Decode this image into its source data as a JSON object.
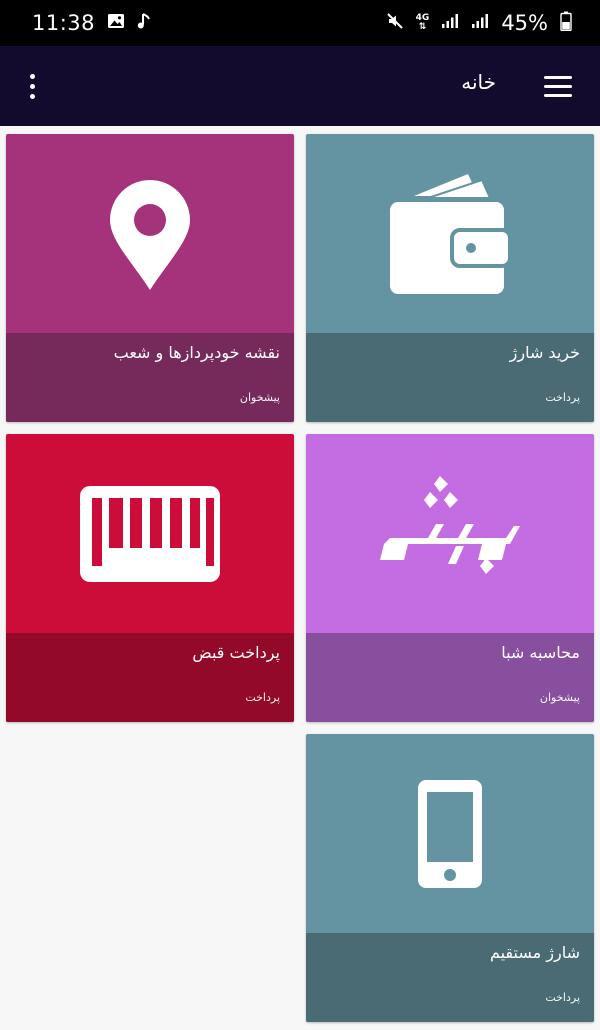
{
  "status_bar": {
    "time": "11:38",
    "network_type": "4G",
    "battery_percent": "45%",
    "left_icons": [
      "image-icon",
      "music-note-icon"
    ],
    "right_icons": [
      "mute-icon",
      "signal-icon",
      "signal-icon",
      "battery-icon"
    ]
  },
  "app_bar": {
    "title": "خانه",
    "menu_icon": "hamburger-menu-icon",
    "more_icon": "more-vert-icon",
    "background": "#120b2e"
  },
  "tiles": [
    {
      "title": "خرید شارژ",
      "subtitle": "پرداخت",
      "icon": "wallet-icon",
      "color": "#6494a1",
      "caption_color": "#4a6b74"
    },
    {
      "title": "نقشه خودپردازها و شعب",
      "subtitle": "پیشخوان",
      "icon": "location-pin-icon",
      "color": "#a4337b",
      "caption_color": "#752a5b"
    },
    {
      "title": "محاسبه شبا",
      "subtitle": "پیشخوان",
      "icon": "sheba-logo-icon",
      "color": "#c46ce1",
      "caption_color": "#894f9f"
    },
    {
      "title": "پرداخت قبض",
      "subtitle": "پرداخت",
      "icon": "barcode-icon",
      "color": "#cc0d3a",
      "caption_color": "#93092a"
    },
    {
      "title": "شارژ مستقیم",
      "subtitle": "پرداخت",
      "icon": "mobile-phone-icon",
      "color": "#6494a1",
      "caption_color": "#4a6b74"
    }
  ]
}
